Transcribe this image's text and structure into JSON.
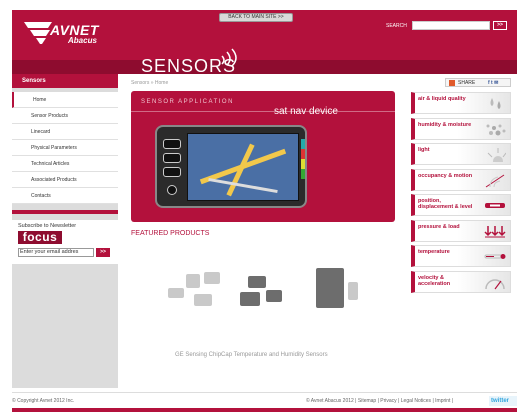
{
  "header": {
    "back_label": "BACK TO MAIN SITE >>",
    "logo_avnet": "AVNET",
    "logo_abacus": "Abacus",
    "search_label": "SEARCH",
    "search_value": "",
    "search_go": ">>",
    "section_title": "SENSORS"
  },
  "sidebar": {
    "heading": "Sensors",
    "items": [
      {
        "label": "Home"
      },
      {
        "label": "Sensor Products"
      },
      {
        "label": "Linecard"
      },
      {
        "label": "Physical Parameters"
      },
      {
        "label": "Technical Articles"
      },
      {
        "label": "Associated Products"
      },
      {
        "label": "Contacts"
      }
    ],
    "subscribe_label": "Subscribe to Newsletter",
    "focus_logo": "focus",
    "email_value": "Enter your email addres",
    "email_go": ">>"
  },
  "breadcrumb": "Sensors » Home",
  "share": {
    "label": "SHARE",
    "social": "f t ✉"
  },
  "banner": {
    "subtitle": "SENSOR APPLICATION",
    "title": "sat nav device"
  },
  "categories": [
    {
      "label": "air & liquid quality",
      "icon": "droplets-icon"
    },
    {
      "label": "humidity & moisture",
      "icon": "moisture-dots-icon"
    },
    {
      "label": "light",
      "icon": "sun-icon"
    },
    {
      "label": "occupancy & motion",
      "icon": "motion-radar-icon"
    },
    {
      "label": "position, displacement & level",
      "icon": "slider-icon"
    },
    {
      "label": "pressure & load",
      "icon": "pressure-arrows-icon"
    },
    {
      "label": "temperature",
      "icon": "thermometer-icon"
    },
    {
      "label": "velocity & acceleration",
      "icon": "speedometer-icon"
    }
  ],
  "featured": {
    "heading": "FEATURED PRODUCTS",
    "caption": "GE Sensing ChipCap Temperature and Humidity Sensors"
  },
  "footer": {
    "copyright": "© Copyright Avnet 2012 Inc.",
    "links": "© Avnet Abacus 2012 | Sitemap | Privacy | Legal Notices | Imprint |",
    "twitter": "twitter"
  },
  "colors": {
    "brand": "#b3113c",
    "brand_dark": "#8e0c2f"
  }
}
